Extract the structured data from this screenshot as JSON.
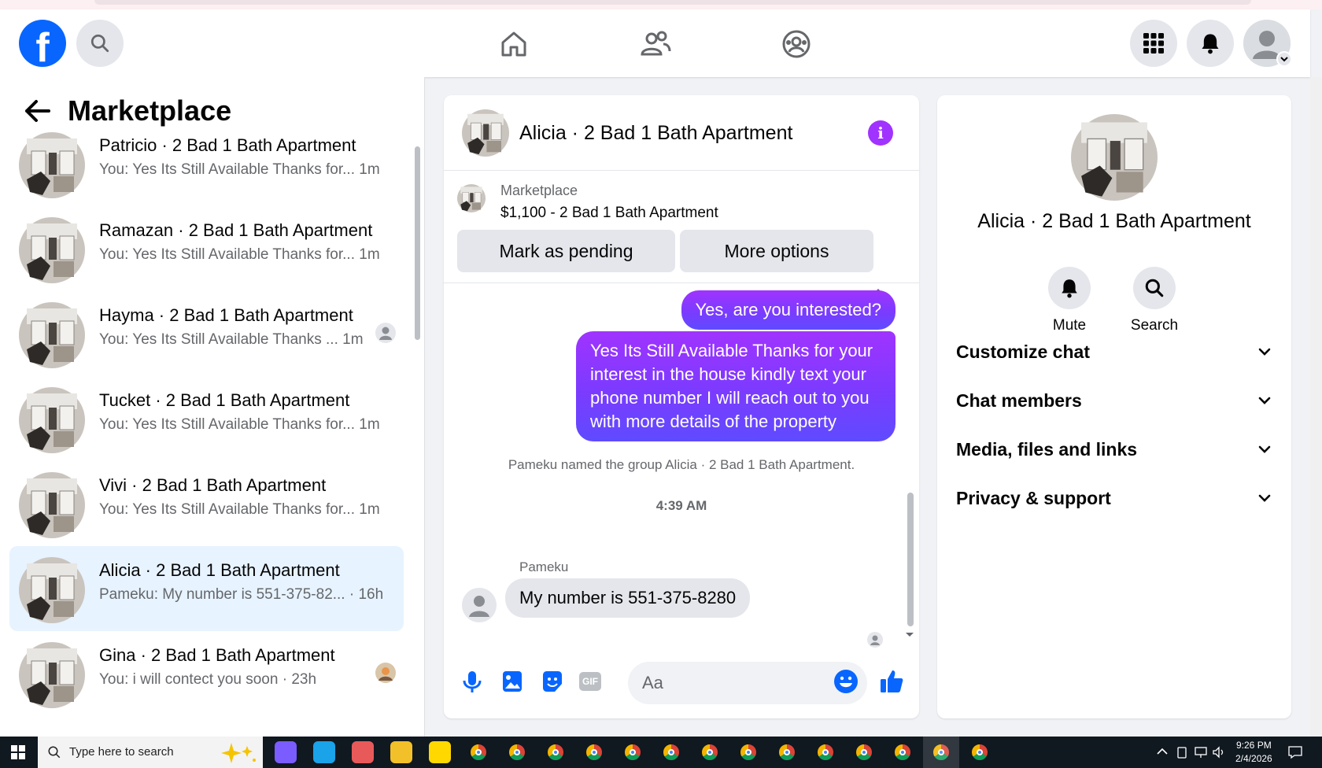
{
  "app": {
    "brand_letter": "f",
    "accent": "#0866ff"
  },
  "sidebar": {
    "title": "Marketplace",
    "conversations": [
      {
        "name": "Patricio · 2 Bad 1 Bath Apartment",
        "snippet": "You: Yes Its Still Available Thanks for... 1m"
      },
      {
        "name": "Ramazan · 2 Bad 1 Bath Apartment",
        "snippet": "You: Yes Its Still Available Thanks for... 1m"
      },
      {
        "name": "Hayma · 2 Bad 1 Bath Apartment",
        "snippet": "You: Yes Its Still Available Thanks ... 1m"
      },
      {
        "name": "Tucket · 2 Bad 1 Bath Apartment",
        "snippet": "You: Yes Its Still Available Thanks for... 1m"
      },
      {
        "name": "Vivi · 2 Bad 1 Bath Apartment",
        "snippet": "You: Yes Its Still Available Thanks for... 1m"
      },
      {
        "name": "Alicia · 2 Bad 1 Bath Apartment",
        "snippet": "Pameku: My number is 551-375-82... · 16h"
      },
      {
        "name": "Gina · 2 Bad 1 Bath Apartment",
        "snippet": "You: i will contect you soon · 23h"
      }
    ]
  },
  "chat": {
    "title": "Alicia · 2 Bad 1 Bath Apartment",
    "info_icon": "i",
    "listing": {
      "source": "Marketplace",
      "price_title": "$1,100 - 2 Bad 1 Bath Apartment",
      "mark_pending": "Mark as pending",
      "more_options": "More options"
    },
    "messages": {
      "out1": "Yes, are you interested?",
      "out2": "Yes Its Still Available Thanks for your interest in the house kindly text your phone number I will reach out to you with more details of the property",
      "system": "Pameku named the group Alicia · 2 Bad 1 Bath Apartment.",
      "timestamp": "4:39 AM",
      "sender": "Pameku",
      "in1": "My number is 551-375-8280"
    },
    "composer": {
      "placeholder": "Aa",
      "gif_label": "GIF"
    },
    "bubble_colors": [
      "#a033ff",
      "#5f4bff"
    ]
  },
  "details": {
    "title": "Alicia · 2 Bad 1 Bath Apartment",
    "mute": "Mute",
    "search": "Search",
    "sections": [
      "Customize chat",
      "Chat members",
      "Media, files and links",
      "Privacy & support"
    ]
  },
  "taskbar": {
    "search_placeholder": "Type here to search",
    "time": "9:26 PM",
    "date": "2/4/2026"
  }
}
